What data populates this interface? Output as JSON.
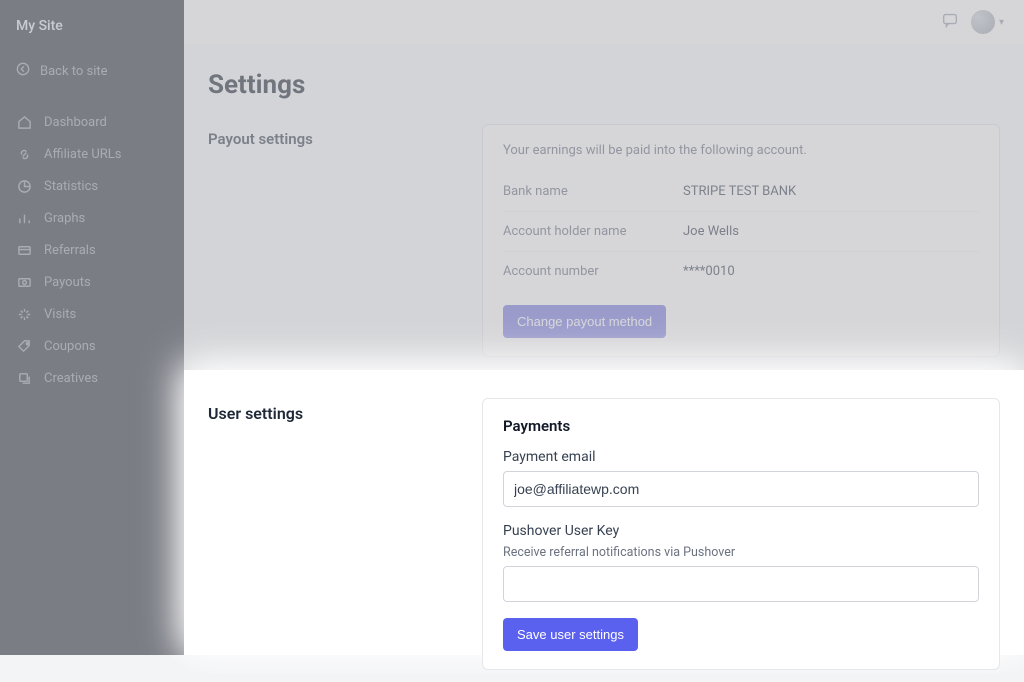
{
  "site_title": "My Site",
  "back_label": "Back to site",
  "nav": [
    {
      "label": "Dashboard"
    },
    {
      "label": "Affiliate URLs"
    },
    {
      "label": "Statistics"
    },
    {
      "label": "Graphs"
    },
    {
      "label": "Referrals"
    },
    {
      "label": "Payouts"
    },
    {
      "label": "Visits"
    },
    {
      "label": "Coupons"
    },
    {
      "label": "Creatives"
    }
  ],
  "page": {
    "title": "Settings"
  },
  "payout": {
    "section_label": "Payout settings",
    "note": "Your earnings will be paid into the following account.",
    "rows": {
      "bank_name_label": "Bank name",
      "bank_name_value": "STRIPE TEST BANK",
      "holder_label": "Account holder name",
      "holder_value": "Joe Wells",
      "number_label": "Account number",
      "number_value": "****0010"
    },
    "change_button": "Change payout method"
  },
  "user": {
    "section_label": "User settings",
    "card_title": "Payments",
    "payment_email_label": "Payment email",
    "payment_email_value": "joe@affiliatewp.com",
    "pushover_label": "Pushover User Key",
    "pushover_help": "Receive referral notifications via Pushover",
    "pushover_value": "",
    "save_button": "Save user settings"
  },
  "colors": {
    "primary": "#5b61ef",
    "sidebar_bg": "#353b45"
  }
}
